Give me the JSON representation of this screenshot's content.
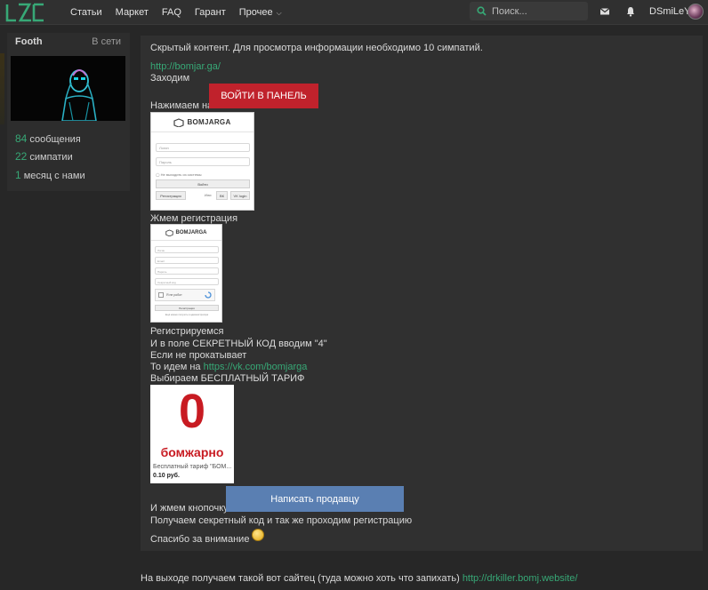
{
  "header": {
    "logo_text": "LZT",
    "nav": [
      "Статьи",
      "Маркет",
      "FAQ",
      "Гарант",
      "Прочее"
    ],
    "search_placeholder": "Поиск...",
    "username": "DSmiLeY",
    "colors": {
      "accent": "#37a876",
      "topbar": "#303030"
    }
  },
  "sidebar": {
    "name": "Footh",
    "status": "В сети",
    "stats": [
      {
        "num": "84",
        "label": "сообщения"
      },
      {
        "num": "22",
        "label": "симпатии"
      },
      {
        "num": "1",
        "label": "месяц с нами"
      }
    ]
  },
  "post": {
    "hidden_notice": "Скрытый контент. Для просмотра информации необходимо 10 симпатий.",
    "link1": "http://bomjar.ga/",
    "t_enter": "Заходим",
    "t_press_on": "Нажимаем на",
    "btn_panel": "ВОЙТИ В ПАНЕЛЬ",
    "t_register": "Жмем регистрация",
    "t_registering": "Регистрируемся",
    "t_secret": "И в поле СЕКРЕТНЫЙ КОД вводим \"4\"",
    "t_fail": "Если не прокатывает",
    "t_goto": "То идем на",
    "link_vk": "https://vk.com/bomjarga",
    "t_choose": "Выбираем БЕСПЛАТНЫЙ ТАРИФ",
    "t_press_btn": "И жмем кнопочку",
    "btn_seller": "Написать продавцу",
    "t_get_code": "Получаем секретный код и так же проходим регистрацию",
    "t_thanks": "Спасибо за внимание",
    "shot1": {
      "brand": "BOMJARGA",
      "login": "Логин",
      "password": "Пароль",
      "remember": "Не выходить из системы",
      "enter": "Войти",
      "register": "Регистрация",
      "or": "Или",
      "vk": "ВК",
      "vk_login": "VK login"
    },
    "shot2": {
      "brand": "BOMJARGA",
      "fields": [
        "Логин",
        "Email",
        "Пароль",
        "Секретный код"
      ],
      "captcha": "Я не робот",
      "submit": "Регистрация",
      "footer": "Ещё можно получить в администратора"
    },
    "tile": {
      "big": "0",
      "name": "бомжарно",
      "desc": "Бесплатный тариф \"БОМ...",
      "price": "0.10 руб."
    }
  },
  "footer": {
    "text": "На выходе получаем такой вот сайтец (туда можно хоть что запихать)",
    "link": "http://drkiller.bomj.website/"
  }
}
